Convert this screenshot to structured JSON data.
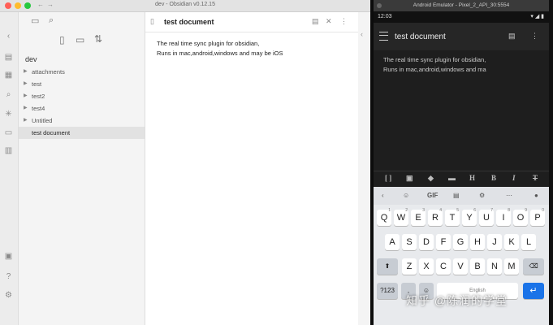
{
  "obsidian": {
    "window_title": "dev - Obsidian v0.12.15",
    "vault_name": "dev",
    "tree": [
      {
        "label": "attachments",
        "folder": true,
        "active": false
      },
      {
        "label": "test",
        "folder": true,
        "active": false
      },
      {
        "label": "test2",
        "folder": true,
        "active": false
      },
      {
        "label": "test4",
        "folder": true,
        "active": false
      },
      {
        "label": "Untitled",
        "folder": true,
        "active": false
      },
      {
        "label": "test document",
        "folder": false,
        "active": true
      }
    ],
    "doc_title": "test document",
    "body_line1": "The real time sync plugin for obsidian,",
    "body_line2": "Runs in mac,android,windows and may be iOS"
  },
  "emulator": {
    "window_title": "Android Emulator - Pixel_2_API_30:5554",
    "status_time": "12:03",
    "app_title": "test document",
    "body_line1": "The real time sync plugin for obsidian,",
    "body_line2": "Runs in mac,android,windows and ma",
    "keyboard": {
      "suggestion_gif": "GIF",
      "row1": [
        "Q",
        "W",
        "E",
        "R",
        "T",
        "Y",
        "U",
        "I",
        "O",
        "P"
      ],
      "row1_nums": [
        "1",
        "2",
        "3",
        "4",
        "5",
        "6",
        "7",
        "8",
        "9",
        "0"
      ],
      "row2": [
        "A",
        "S",
        "D",
        "F",
        "G",
        "H",
        "J",
        "K",
        "L"
      ],
      "row3": [
        "Z",
        "X",
        "C",
        "V",
        "B",
        "N",
        "M"
      ],
      "symbols_key": "?123",
      "comma_key": ",",
      "space_label": "English",
      "period_key": "."
    }
  },
  "watermark": "知乎 @陈润的学堂",
  "colors": {
    "accent_blue": "#1a73e8",
    "traffic_red": "#ff5f57",
    "traffic_yellow": "#febc2e",
    "traffic_green": "#28c840"
  }
}
